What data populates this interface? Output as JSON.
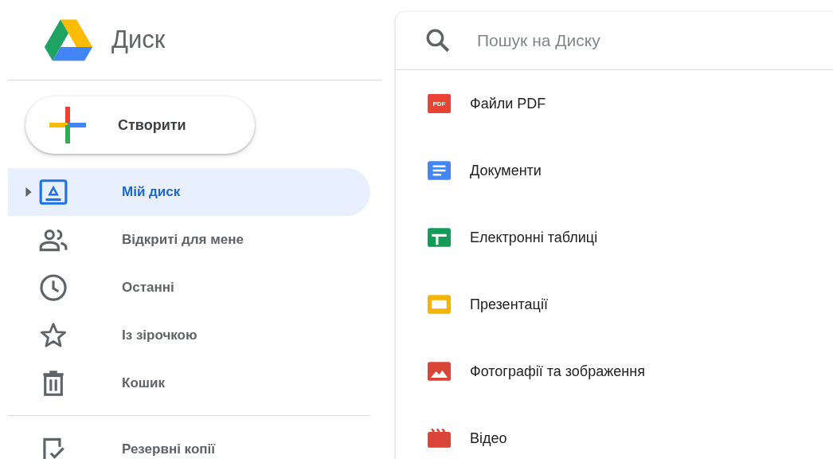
{
  "app": {
    "title": "Диск"
  },
  "create_button": {
    "label": "Створити"
  },
  "nav": [
    {
      "label": "Мій диск",
      "kind": "drive",
      "selected": true,
      "has_children": true
    },
    {
      "label": "Відкриті для мене",
      "kind": "people",
      "selected": false,
      "has_children": false
    },
    {
      "label": "Останні",
      "kind": "clock",
      "selected": false,
      "has_children": false
    },
    {
      "label": "Із зірочкою",
      "kind": "star",
      "selected": false,
      "has_children": false
    },
    {
      "label": "Кошик",
      "kind": "trash",
      "selected": false,
      "has_children": false
    }
  ],
  "nav_secondary": [
    {
      "label": "Резервні копії",
      "kind": "backup",
      "selected": false,
      "has_children": false
    }
  ],
  "search": {
    "placeholder": "Пошук на Диску"
  },
  "file_types": [
    {
      "kind": "pdf",
      "label": "Файли PDF",
      "icon_text": "PDF"
    },
    {
      "kind": "doc",
      "label": "Документи"
    },
    {
      "kind": "sheet",
      "label": "Електронні таблиці"
    },
    {
      "kind": "slides",
      "label": "Презентації"
    },
    {
      "kind": "image",
      "label": "Фотографії та зображення"
    },
    {
      "kind": "video",
      "label": "Відео"
    }
  ]
}
